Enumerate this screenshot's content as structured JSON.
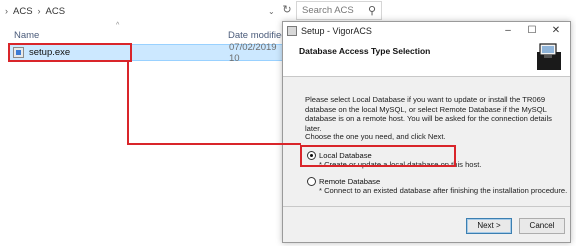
{
  "explorer": {
    "breadcrumb": [
      "ACS",
      "ACS"
    ],
    "search_placeholder": "Search ACS",
    "columns": {
      "name": "Name",
      "date": "Date modified"
    },
    "file": {
      "name": "setup.exe",
      "date": "07/02/2019 10"
    }
  },
  "dialog": {
    "title": "Setup - VigorACS",
    "header_title": "Database Access Type Selection",
    "description": "Please select Local Database if you want to update or install the TR069 database on the local MySQL, or select Remote Database if the MySQL database is on a remote host. You will be asked for the connection details later.",
    "prompt": "Choose the one you need, and click Next.",
    "options": [
      {
        "label": "Local Database",
        "detail": "* Create or update a local database on this host.",
        "selected": true
      },
      {
        "label": "Remote Database",
        "detail": "* Connect to an existed database after finishing the installation procedure.",
        "selected": false
      }
    ],
    "next_label": "Next >",
    "cancel_label": "Cancel"
  },
  "highlight_color": "#d9252a",
  "selection_color": "#cce8ff"
}
